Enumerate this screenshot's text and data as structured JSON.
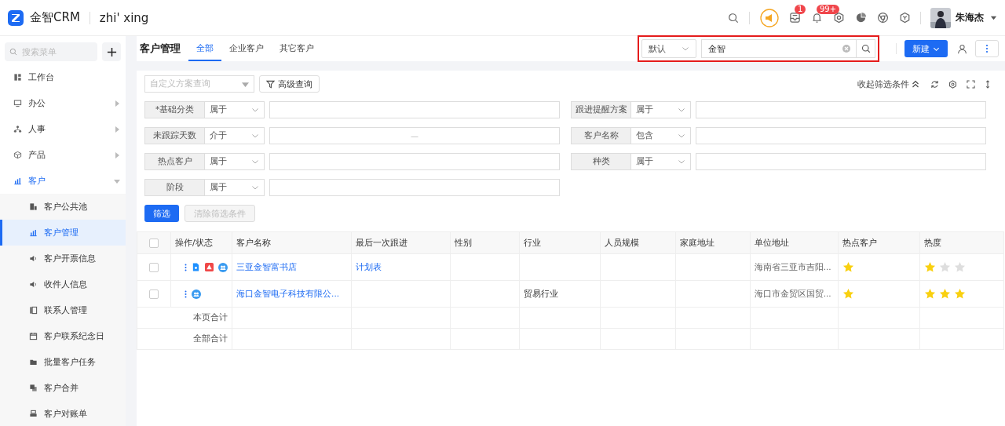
{
  "app": {
    "logo_text": "金智CRM",
    "workspace": "zhi' xing"
  },
  "top_icons": [
    {
      "kind": "search"
    },
    {
      "kind": "announce"
    },
    {
      "kind": "inbox",
      "badge": "1"
    },
    {
      "kind": "bell",
      "badge": "99+"
    },
    {
      "kind": "settings"
    },
    {
      "kind": "pie"
    },
    {
      "kind": "browser"
    },
    {
      "kind": "cube"
    }
  ],
  "user": {
    "name": "朱海杰"
  },
  "sidebar": {
    "search_placeholder": "搜索菜单",
    "items": [
      {
        "label": "工作台",
        "kind": "link",
        "selected": false
      },
      {
        "label": "办公",
        "kind": "group",
        "expanded": false,
        "selected": false
      },
      {
        "label": "人事",
        "kind": "group",
        "expanded": false,
        "selected": false
      },
      {
        "label": "产品",
        "kind": "group",
        "expanded": false,
        "selected": false
      },
      {
        "label": "客户",
        "kind": "group",
        "expanded": true,
        "selected": true,
        "children": [
          {
            "label": "客户公共池",
            "selected": false
          },
          {
            "label": "客户管理",
            "selected": true
          },
          {
            "label": "客户开票信息",
            "selected": false
          },
          {
            "label": "收件人信息",
            "selected": false
          },
          {
            "label": "联系人管理",
            "selected": false
          },
          {
            "label": "客户联系纪念日",
            "selected": false
          },
          {
            "label": "批量客户任务",
            "selected": false
          },
          {
            "label": "客户合并",
            "selected": false
          },
          {
            "label": "客户对账单",
            "selected": false
          }
        ]
      }
    ]
  },
  "page": {
    "title": "客户管理",
    "tabs": [
      {
        "label": "全部",
        "selected": true
      },
      {
        "label": "企业客户",
        "selected": false
      },
      {
        "label": "其它客户",
        "selected": false
      }
    ],
    "search": {
      "scope": "默认",
      "value": "金智"
    },
    "new_button": "新建"
  },
  "toolbar": {
    "scheme_placeholder": "自定义方案查询",
    "advanced": "高级查询",
    "collapse": "收起筛选条件"
  },
  "filters": [
    {
      "label": "*基础分类",
      "operator": "属于"
    },
    {
      "label": "跟进提醒方案",
      "operator": "属于"
    },
    {
      "label": "未跟踪天数",
      "operator": "介于",
      "separator": "—"
    },
    {
      "label": "客户名称",
      "operator": "包含"
    },
    {
      "label": "热点客户",
      "operator": "属于"
    },
    {
      "label": "种类",
      "operator": "属于"
    },
    {
      "label": "阶段",
      "operator": "属于"
    }
  ],
  "filter_actions": [
    {
      "label": "筛选",
      "disabled": false
    },
    {
      "label": "清除筛选条件",
      "disabled": true
    }
  ],
  "table": {
    "header_checked": false,
    "columns": [
      "操作/状态",
      "客户名称",
      "最后一次跟进",
      "性别",
      "行业",
      "人员规模",
      "家庭地址",
      "单位地址",
      "热点客户",
      "热度"
    ],
    "rows": [
      {
        "checked": false,
        "status_icons": [
          {
            "kind": "document"
          },
          {
            "kind": "warning"
          },
          {
            "kind": "group"
          }
        ],
        "name": "三亚金智富书店",
        "last_follow": "计划表",
        "work_address": "海南省三亚市吉阳...",
        "hot": true,
        "heat": {
          "stars": 1
        }
      },
      {
        "checked": false,
        "status_icons": [
          {
            "kind": "group"
          }
        ],
        "name": "海口金智电子科技有限公...",
        "industry": "贸易行业",
        "work_address": "海口市金贸区国贸...",
        "hot": true,
        "heat": {
          "stars": 3
        }
      }
    ],
    "totals": [
      "本页合计",
      "全部合计"
    ]
  }
}
